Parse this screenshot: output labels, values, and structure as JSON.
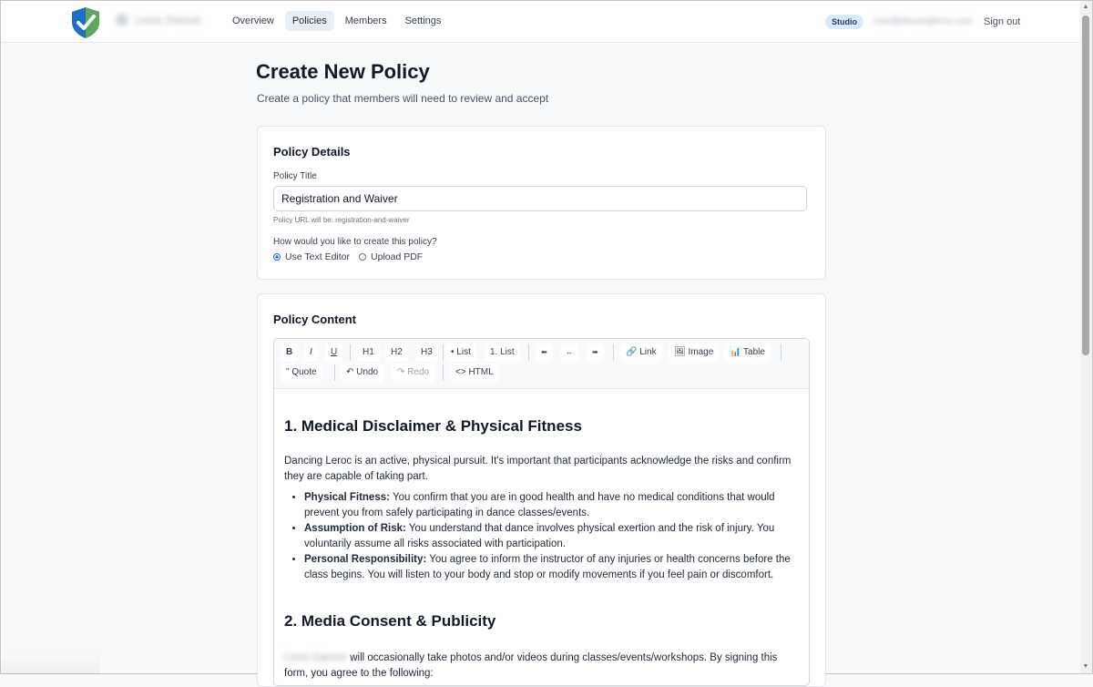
{
  "header": {
    "account_name": "Leroc Dancer",
    "nav": [
      {
        "label": "Overview"
      },
      {
        "label": "Policies"
      },
      {
        "label": "Members"
      },
      {
        "label": "Settings"
      }
    ],
    "studio_badge": "Studio",
    "user_email": "user@dancingleroc.com",
    "sign_out": "Sign out"
  },
  "page": {
    "title": "Create New Policy",
    "subtitle": "Create a policy that members will need to review and accept"
  },
  "details_card": {
    "title": "Policy Details",
    "title_label": "Policy Title",
    "title_value": "Registration and Waiver",
    "url_hint": "Policy URL will be: registration-and-waiver",
    "method_question": "How would you like to create this policy?",
    "options": [
      {
        "label": "Use Text Editor",
        "selected": true
      },
      {
        "label": "Upload PDF",
        "selected": false
      }
    ]
  },
  "content_card": {
    "title": "Policy Content",
    "toolbar": {
      "bold": "B",
      "italic": "I",
      "underline": "U",
      "h1": "H1",
      "h2": "H2",
      "h3": "H3",
      "bullet_list": "• List",
      "numbered_list": "1. List",
      "align_left": "⬅",
      "align_center": "↔",
      "align_right": "➡",
      "link": "🔗 Link",
      "image": "🖼 Image",
      "table": "📊 Table",
      "quote": "\" Quote",
      "undo": "↶ Undo",
      "redo": "↷ Redo",
      "html": "<> HTML"
    },
    "section1": {
      "heading": "1. Medical Disclaimer & Physical Fitness",
      "intro": "Dancing Leroc is an active, physical pursuit. It's important that participants acknowledge the risks and confirm they are capable of taking part.",
      "items": [
        {
          "term": "Physical Fitness:",
          "text": "You confirm that you are in good health and have no medical conditions that would prevent you from safely participating in dance classes/events."
        },
        {
          "term": "Assumption of Risk:",
          "text": "You understand that dance involves physical exertion and the risk of injury. You voluntarily assume all risks associated with participation."
        },
        {
          "term": "Personal Responsibility:",
          "text": "You agree to inform the instructor of any injuries or health concerns before the class begins. You will listen to your body and stop or modify movements if you feel pain or discomfort."
        }
      ]
    },
    "section2": {
      "heading": "2. Media Consent & Publicity",
      "org_name": "Leroc Dancer",
      "intro": "will occasionally take photos and/or videos during classes/events/workshops. By signing this form, you agree to the following:"
    }
  },
  "colors": {
    "accent": "#2563eb",
    "active_nav": "#e6eff8",
    "studio_badge": "#dbeafe",
    "logo_blue": "#1d6fc4",
    "logo_green": "#6ab04c"
  }
}
